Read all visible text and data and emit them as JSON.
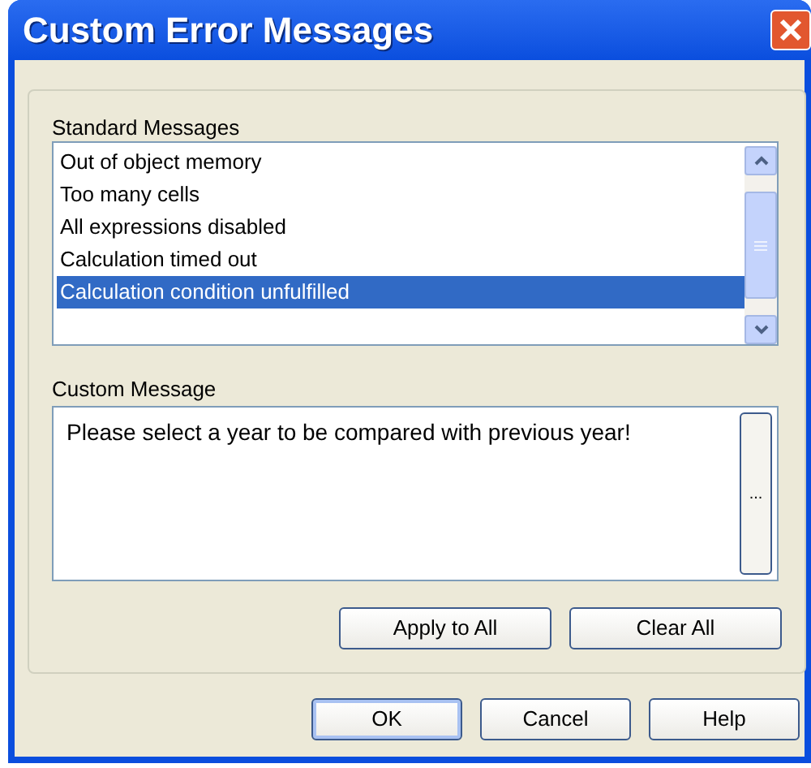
{
  "window": {
    "title": "Custom Error Messages"
  },
  "standard_messages": {
    "label": "Standard Messages",
    "items": [
      {
        "text": "Out of object memory",
        "selected": false
      },
      {
        "text": "Too many cells",
        "selected": false
      },
      {
        "text": "All expressions disabled",
        "selected": false
      },
      {
        "text": "Calculation timed out",
        "selected": false
      },
      {
        "text": "Calculation condition unfulfilled",
        "selected": true
      }
    ]
  },
  "custom_message": {
    "label": "Custom Message",
    "value": "Please select a year to be compared with previous year!",
    "browse_button": "..."
  },
  "group_buttons": [
    "Apply to All",
    "Clear All"
  ],
  "dialog_buttons": [
    {
      "label": "OK",
      "default": true
    },
    {
      "label": "Cancel",
      "default": false
    },
    {
      "label": "Help",
      "default": false
    }
  ]
}
